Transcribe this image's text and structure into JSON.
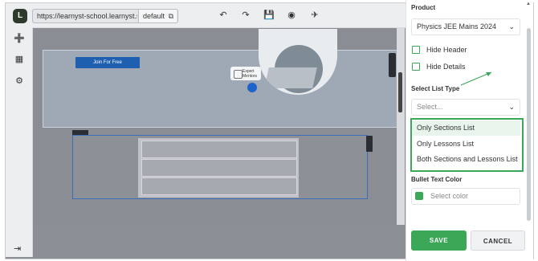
{
  "editor": {
    "url": "https://learnyst-school.learnyst.site/",
    "env": "default",
    "join_button": "Join For Free",
    "badge_line1": "Expert",
    "badge_line2": "Mentors"
  },
  "panel": {
    "product_label": "Product",
    "product_value": "Physics JEE Mains 2024",
    "hide_header": "Hide Header",
    "hide_details": "Hide Details",
    "list_type_label": "Select List Type",
    "list_type_placeholder": "Select...",
    "options": [
      "Only Sections List",
      "Only Lessons List",
      "Both Sections and Lessons List"
    ],
    "bullet_color_label": "Bullet Text Color",
    "color_placeholder": "Select color",
    "save": "SAVE",
    "cancel": "CANCEL"
  },
  "colors": {
    "accent_green": "#3aa856",
    "join_blue": "#1e5fb0"
  },
  "icons": [
    "logo-icon",
    "add-icon",
    "grid-icon",
    "settings-icon",
    "exit-icon",
    "undo-icon",
    "redo-icon",
    "save-icon",
    "preview-icon",
    "publish-icon",
    "copy-icon",
    "chevron-down-icon"
  ]
}
